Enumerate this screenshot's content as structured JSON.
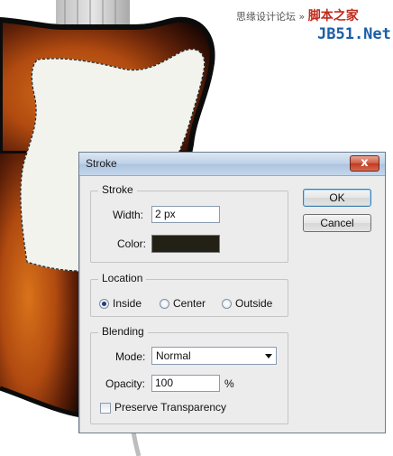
{
  "watermark": {
    "line1_text": "思缘设计论坛 » ",
    "line1_brand": "脚本之家",
    "line2": "JB51.Net"
  },
  "dialog": {
    "title": "Stroke",
    "close_glyph": "x",
    "ok_label": "OK",
    "cancel_label": "Cancel",
    "stroke": {
      "legend": "Stroke",
      "width_label": "Width:",
      "width_value": "2 px",
      "color_label": "Color:",
      "color_value": "#232015"
    },
    "location": {
      "legend": "Location",
      "options": [
        "Inside",
        "Center",
        "Outside"
      ],
      "selected": "Inside"
    },
    "blending": {
      "legend": "Blending",
      "mode_label": "Mode:",
      "mode_value": "Normal",
      "opacity_label": "Opacity:",
      "opacity_value": "100",
      "opacity_unit": "%",
      "preserve_label": "Preserve Transparency",
      "preserve_checked": false
    }
  }
}
